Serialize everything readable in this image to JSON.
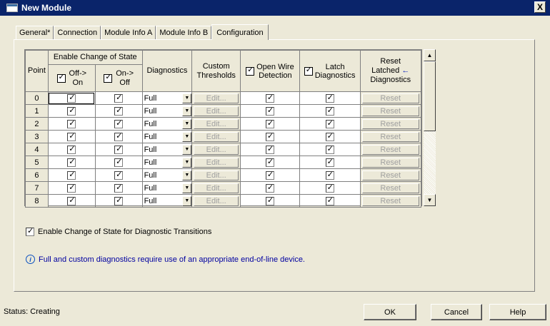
{
  "window": {
    "title": "New Module",
    "close_label": "X"
  },
  "tabs": [
    {
      "label": "General*"
    },
    {
      "label": "Connection"
    },
    {
      "label": "Module Info A"
    },
    {
      "label": "Module Info B"
    },
    {
      "label": "Configuration",
      "active": true
    }
  ],
  "grid": {
    "headers": {
      "point": "Point",
      "enable_cos": "Enable Change of State",
      "off_on_1": "Off->",
      "off_on_2": "On",
      "on_off_1": "On->",
      "on_off_2": "Off",
      "diagnostics": "Diagnostics",
      "custom_1": "Custom",
      "custom_2": "Thresholds",
      "openwire_1": "Open Wire",
      "openwire_2": "Detection",
      "latch_1": "Latch",
      "latch_2": "Diagnostics",
      "reset_1": "Reset",
      "reset_2": "Latched",
      "reset_3": "Diagnostics"
    },
    "rows": [
      {
        "point": "0",
        "diag": "Full",
        "edit": "Edit...",
        "reset": "Reset"
      },
      {
        "point": "1",
        "diag": "Full",
        "edit": "Edit...",
        "reset": "Reset"
      },
      {
        "point": "2",
        "diag": "Full",
        "edit": "Edit...",
        "reset": "Reset"
      },
      {
        "point": "3",
        "diag": "Full",
        "edit": "Edit...",
        "reset": "Reset"
      },
      {
        "point": "4",
        "diag": "Full",
        "edit": "Edit...",
        "reset": "Reset"
      },
      {
        "point": "5",
        "diag": "Full",
        "edit": "Edit...",
        "reset": "Reset"
      },
      {
        "point": "6",
        "diag": "Full",
        "edit": "Edit...",
        "reset": "Reset"
      },
      {
        "point": "7",
        "diag": "Full",
        "edit": "Edit...",
        "reset": "Reset"
      },
      {
        "point": "8",
        "diag": "Full",
        "edit": "Edit...",
        "reset": "Reset"
      }
    ]
  },
  "option": {
    "label": "Enable Change of State for Diagnostic Transitions",
    "checked": true
  },
  "info": {
    "text": "Full and custom diagnostics require use of an appropriate end-of-line device."
  },
  "status": {
    "text": "Status:  Creating"
  },
  "buttons": {
    "ok": "OK",
    "cancel": "Cancel",
    "help": "Help"
  }
}
